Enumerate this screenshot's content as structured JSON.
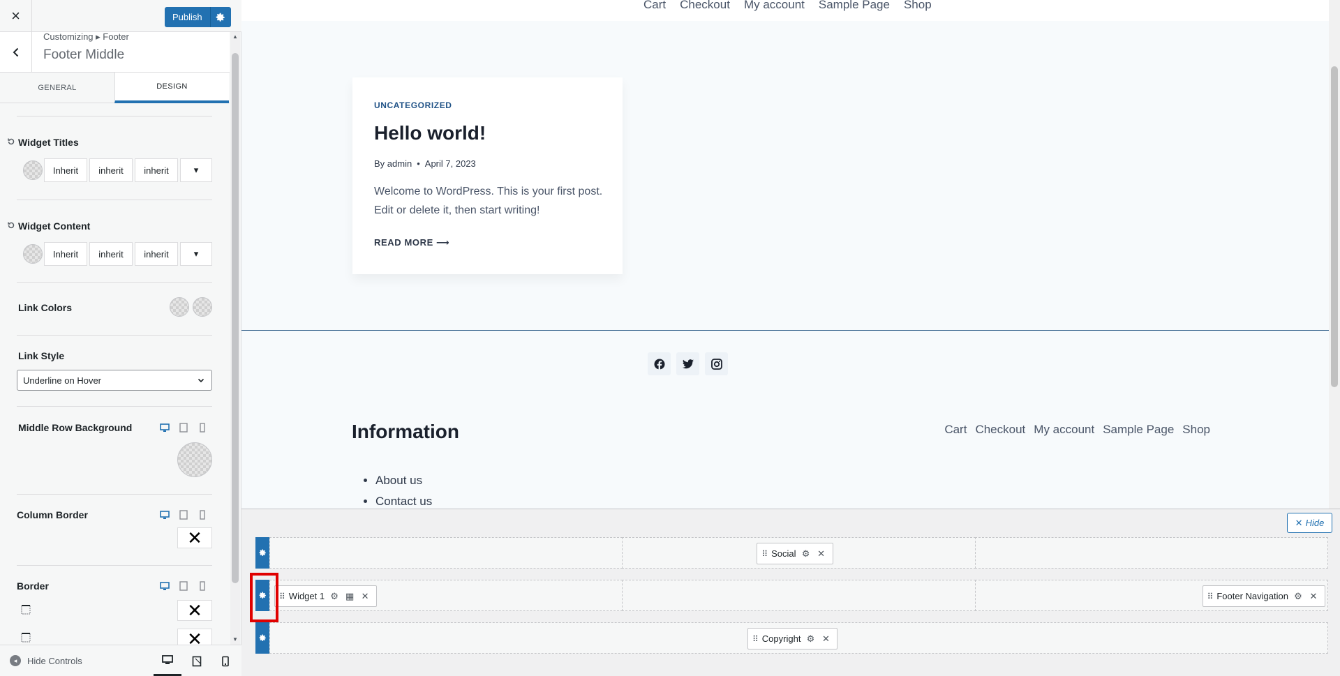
{
  "topbar": {
    "close_label": "×",
    "publish_label": "Publish"
  },
  "section": {
    "breadcrumb": "Customizing ▸ Footer",
    "title": "Footer Middle"
  },
  "tabs": [
    {
      "label": "GENERAL"
    },
    {
      "label": "DESIGN"
    }
  ],
  "controls": {
    "widget_titles": {
      "label": "Widget Titles",
      "font": "Inherit",
      "size": "inherit",
      "line_height": "inherit",
      "dropdown": "▾"
    },
    "widget_content": {
      "label": "Widget Content",
      "font": "Inherit",
      "size": "inherit",
      "line_height": "inherit",
      "dropdown": "▾"
    },
    "link_colors": {
      "label": "Link Colors"
    },
    "link_style": {
      "label": "Link Style",
      "value": "Underline on Hover"
    },
    "middle_row_bg": {
      "label": "Middle Row Background"
    },
    "column_border": {
      "label": "Column Border",
      "value": "✕"
    },
    "border": {
      "label": "Border",
      "top_value": "✕",
      "bottom_value": "✕"
    }
  },
  "sidebar_footer": {
    "hide_controls": "Hide Controls"
  },
  "preview": {
    "nav_links": [
      "Cart",
      "Checkout",
      "My account",
      "Sample Page",
      "Shop"
    ],
    "post": {
      "category": "UNCATEGORIZED",
      "title": "Hello world!",
      "by": "By",
      "author": "admin",
      "separator": "•",
      "date": "April 7, 2023",
      "excerpt": "Welcome to WordPress. This is your first post. Edit or delete it, then start writing!",
      "read_more": "READ MORE ⟶"
    },
    "footer": {
      "social_icons": [
        "facebook-icon",
        "twitter-icon",
        "instagram-icon"
      ],
      "info_title": "Information",
      "info_items": [
        "About us",
        "Contact us"
      ],
      "links": [
        "Cart",
        "Checkout",
        "My account",
        "Sample Page",
        "Shop"
      ]
    }
  },
  "builder": {
    "hide_label": "Hide",
    "rows": [
      {
        "center": "Social"
      },
      {
        "left": "Widget 1",
        "right": "Footer Navigation"
      },
      {
        "center": "Copyright"
      }
    ]
  },
  "colors": {
    "accent": "#2271b1",
    "highlight": "#e00000"
  }
}
